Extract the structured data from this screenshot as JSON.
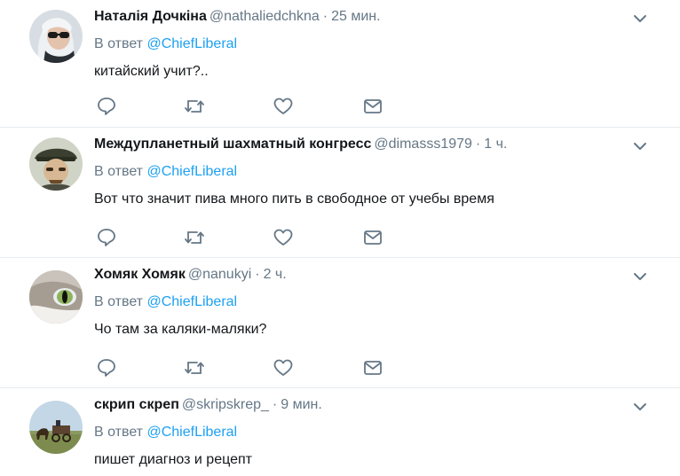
{
  "colors": {
    "link": "#1da1f2",
    "secondary_text": "#657786",
    "primary_text": "#14171a",
    "divider": "#e6ecf0"
  },
  "tweets": [
    {
      "fullname": "Наталія Дочкіна",
      "handle": "@nathaliedchkna",
      "separator": "·",
      "time": "25 мин.",
      "reply_prefix": "В ответ",
      "reply_to": "@ChiefLiberal",
      "text": "китайский учит?..",
      "avatar_icon": "woman-with-sunglasses-avatar"
    },
    {
      "fullname": "Межд­упланетный шахматный конгресс",
      "handle": "@dimasss1979",
      "separator": "·",
      "time": "1 ч.",
      "reply_prefix": "В ответ",
      "reply_to": "@ChiefLiberal",
      "text": "Вот что значит пива много пить в свободное от учебы время",
      "avatar_icon": "man-with-cap-avatar"
    },
    {
      "fullname": "Хомяк Хомяк",
      "handle": "@nanukyi",
      "separator": "·",
      "time": "2 ч.",
      "reply_prefix": "В ответ",
      "reply_to": "@ChiefLiberal",
      "text": "Чо там за каляки-маляки?",
      "avatar_icon": "cat-eye-avatar"
    },
    {
      "fullname": "скрип скреп",
      "handle": "@skripskrep_",
      "separator": "·",
      "time": "9 мин.",
      "reply_prefix": "В ответ",
      "reply_to": "@ChiefLiberal",
      "text": "пишет диагноз и рецепт",
      "avatar_icon": "horse-cart-avatar"
    }
  ]
}
